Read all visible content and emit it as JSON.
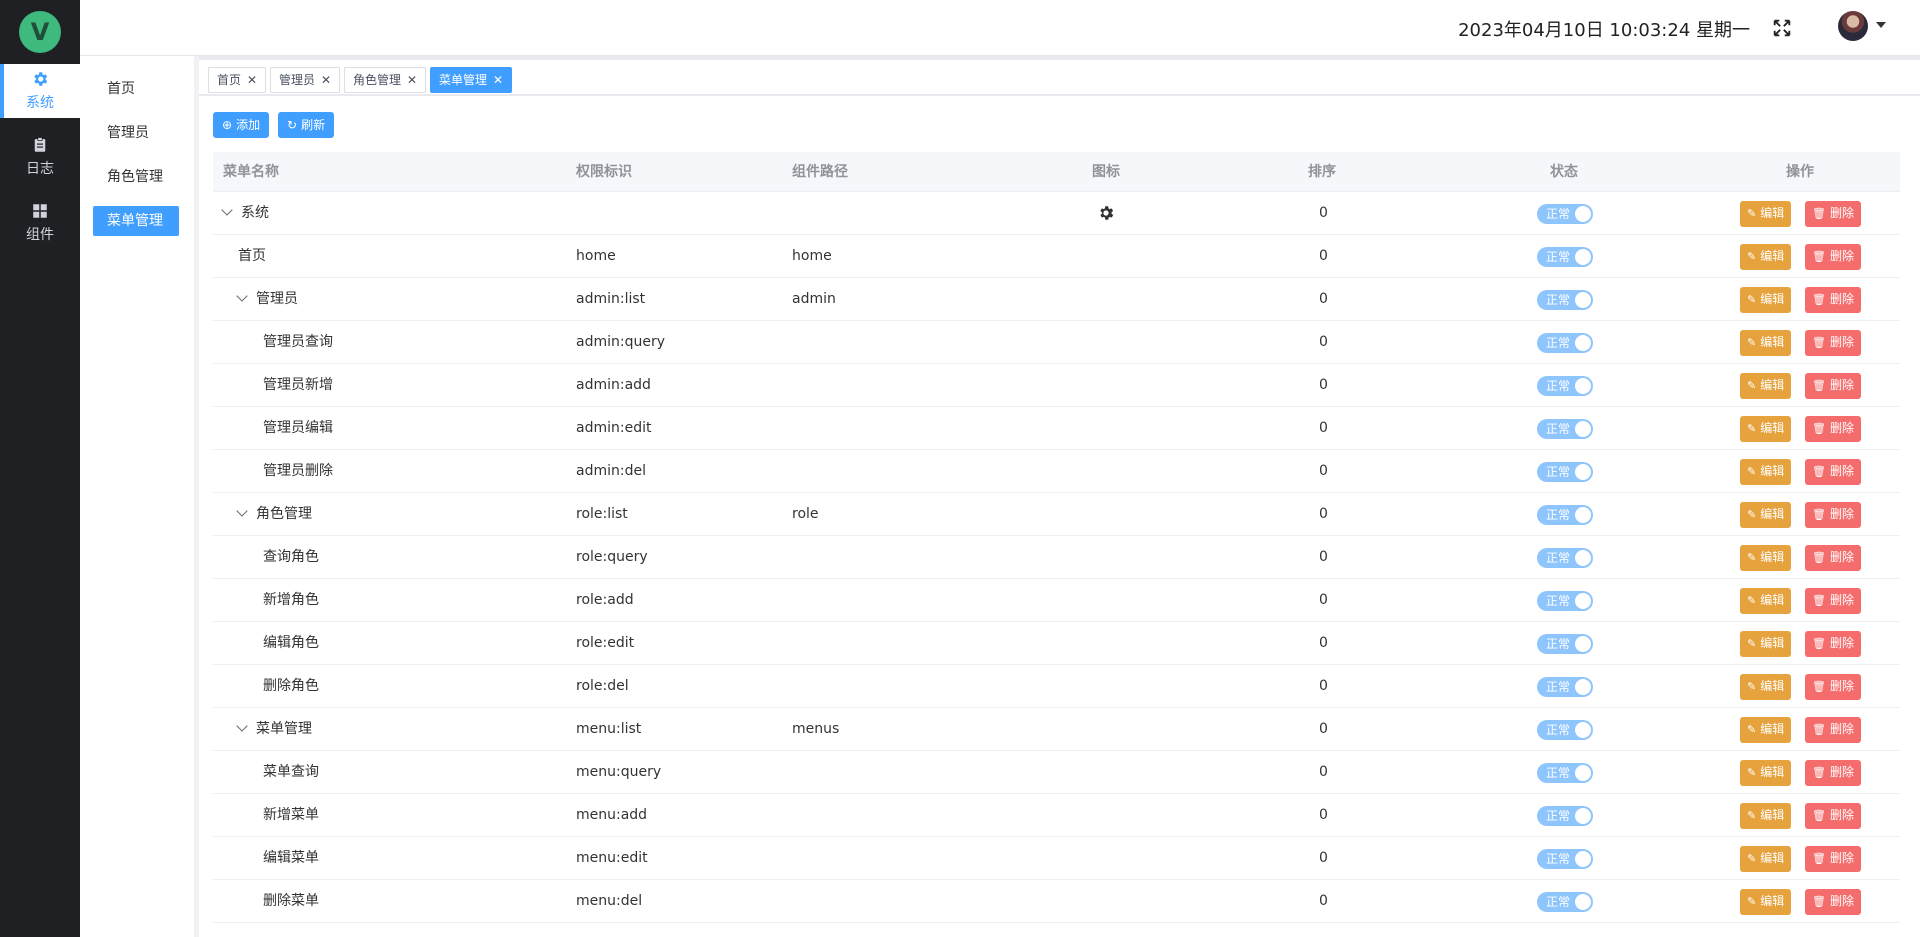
{
  "brand": {
    "logo_letter": "V",
    "logo_color": "#3dba7c"
  },
  "rail": [
    {
      "label": "系统",
      "icon": "gear-icon",
      "active": true
    },
    {
      "label": "日志",
      "icon": "clipboard-icon",
      "active": false
    },
    {
      "label": "组件",
      "icon": "grid-icon",
      "active": false
    }
  ],
  "submenu": [
    {
      "label": "首页",
      "active": false
    },
    {
      "label": "管理员",
      "active": false
    },
    {
      "label": "角色管理",
      "active": false
    },
    {
      "label": "菜单管理",
      "active": true
    }
  ],
  "header": {
    "datetime": "2023年04月10日 10:03:24 星期一"
  },
  "tags": [
    {
      "label": "首页",
      "active": false
    },
    {
      "label": "管理员",
      "active": false
    },
    {
      "label": "角色管理",
      "active": false
    },
    {
      "label": "菜单管理",
      "active": true
    }
  ],
  "toolbar": {
    "add_label": "添加",
    "refresh_label": "刷新"
  },
  "table": {
    "columns": [
      "菜单名称",
      "权限标识",
      "组件路径",
      "图标",
      "排序",
      "状态",
      "操作"
    ],
    "status_label": "正常",
    "edit_label": "编辑",
    "delete_label": "删除",
    "rows": [
      {
        "name": "系统",
        "level": 0,
        "expanded": true,
        "perm": "",
        "path": "",
        "icon": "gear-icon",
        "sort": "0"
      },
      {
        "name": "首页",
        "level": 1,
        "expanded": false,
        "perm": "home",
        "path": "home",
        "icon": "",
        "sort": "0"
      },
      {
        "name": "管理员",
        "level": 1,
        "expanded": true,
        "perm": "admin:list",
        "path": "admin",
        "icon": "",
        "sort": "0"
      },
      {
        "name": "管理员查询",
        "level": 2,
        "expanded": false,
        "perm": "admin:query",
        "path": "",
        "icon": "",
        "sort": "0"
      },
      {
        "name": "管理员新增",
        "level": 2,
        "expanded": false,
        "perm": "admin:add",
        "path": "",
        "icon": "",
        "sort": "0"
      },
      {
        "name": "管理员编辑",
        "level": 2,
        "expanded": false,
        "perm": "admin:edit",
        "path": "",
        "icon": "",
        "sort": "0"
      },
      {
        "name": "管理员删除",
        "level": 2,
        "expanded": false,
        "perm": "admin:del",
        "path": "",
        "icon": "",
        "sort": "0"
      },
      {
        "name": "角色管理",
        "level": 1,
        "expanded": true,
        "perm": "role:list",
        "path": "role",
        "icon": "",
        "sort": "0"
      },
      {
        "name": "查询角色",
        "level": 2,
        "expanded": false,
        "perm": "role:query",
        "path": "",
        "icon": "",
        "sort": "0"
      },
      {
        "name": "新增角色",
        "level": 2,
        "expanded": false,
        "perm": "role:add",
        "path": "",
        "icon": "",
        "sort": "0"
      },
      {
        "name": "编辑角色",
        "level": 2,
        "expanded": false,
        "perm": "role:edit",
        "path": "",
        "icon": "",
        "sort": "0"
      },
      {
        "name": "删除角色",
        "level": 2,
        "expanded": false,
        "perm": "role:del",
        "path": "",
        "icon": "",
        "sort": "0"
      },
      {
        "name": "菜单管理",
        "level": 1,
        "expanded": true,
        "perm": "menu:list",
        "path": "menus",
        "icon": "",
        "sort": "0"
      },
      {
        "name": "菜单查询",
        "level": 2,
        "expanded": false,
        "perm": "menu:query",
        "path": "",
        "icon": "",
        "sort": "0"
      },
      {
        "name": "新增菜单",
        "level": 2,
        "expanded": false,
        "perm": "menu:add",
        "path": "",
        "icon": "",
        "sort": "0"
      },
      {
        "name": "编辑菜单",
        "level": 2,
        "expanded": false,
        "perm": "menu:edit",
        "path": "",
        "icon": "",
        "sort": "0"
      },
      {
        "name": "删除菜单",
        "level": 2,
        "expanded": false,
        "perm": "menu:del",
        "path": "",
        "icon": "",
        "sort": "0"
      }
    ]
  },
  "colors": {
    "primary": "#409eff",
    "edit": "#e6a23c",
    "delete": "#f56c6c",
    "switch": "#8ec5fc",
    "rail": "#1f2023"
  }
}
